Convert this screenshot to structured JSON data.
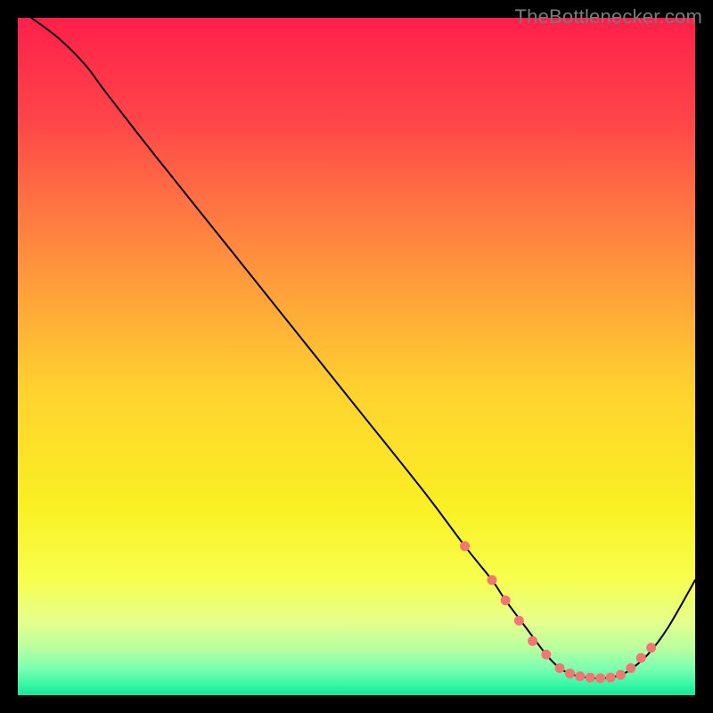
{
  "watermark": "TheBottlenecker.com",
  "chart_data": {
    "type": "line",
    "title": "",
    "xlabel": "",
    "ylabel": "",
    "xlim": [
      0,
      100
    ],
    "ylim": [
      0,
      100
    ],
    "grid": false,
    "background_gradient": {
      "stops": [
        {
          "offset": 0.0,
          "color": "#ff1f4a"
        },
        {
          "offset": 0.15,
          "color": "#ff4549"
        },
        {
          "offset": 0.35,
          "color": "#ff8e3e"
        },
        {
          "offset": 0.55,
          "color": "#ffd22e"
        },
        {
          "offset": 0.72,
          "color": "#faf022"
        },
        {
          "offset": 0.83,
          "color": "#f7ff4d"
        },
        {
          "offset": 0.89,
          "color": "#e6ff8a"
        },
        {
          "offset": 0.93,
          "color": "#b9ffa0"
        },
        {
          "offset": 0.96,
          "color": "#7dffb0"
        },
        {
          "offset": 0.985,
          "color": "#35f7a4"
        },
        {
          "offset": 1.0,
          "color": "#18e698"
        }
      ]
    },
    "series": [
      {
        "name": "curve",
        "stroke": "#000000",
        "stroke_width": 2,
        "x": [
          2,
          6,
          10,
          13,
          20,
          30,
          40,
          50,
          60,
          66,
          70,
          72,
          75,
          78,
          80,
          82,
          85,
          88,
          90,
          93,
          96,
          100
        ],
        "y": [
          100,
          97,
          93,
          89,
          80,
          67.5,
          55,
          42.5,
          30,
          22,
          17,
          14,
          10,
          6,
          4,
          3,
          2.5,
          2.7,
          3.5,
          6,
          10,
          17
        ]
      }
    ],
    "markers": {
      "color": "#f67472",
      "radius": 5.5,
      "points": [
        {
          "x": 66,
          "y": 22
        },
        {
          "x": 70,
          "y": 17
        },
        {
          "x": 72,
          "y": 14
        },
        {
          "x": 74,
          "y": 11
        },
        {
          "x": 76,
          "y": 8
        },
        {
          "x": 78,
          "y": 6
        },
        {
          "x": 80,
          "y": 4
        },
        {
          "x": 81.5,
          "y": 3.2
        },
        {
          "x": 83,
          "y": 2.8
        },
        {
          "x": 84.5,
          "y": 2.6
        },
        {
          "x": 86,
          "y": 2.5
        },
        {
          "x": 87.5,
          "y": 2.6
        },
        {
          "x": 89,
          "y": 3
        },
        {
          "x": 90.5,
          "y": 4
        },
        {
          "x": 92,
          "y": 5.5
        },
        {
          "x": 93.5,
          "y": 7
        }
      ]
    }
  }
}
